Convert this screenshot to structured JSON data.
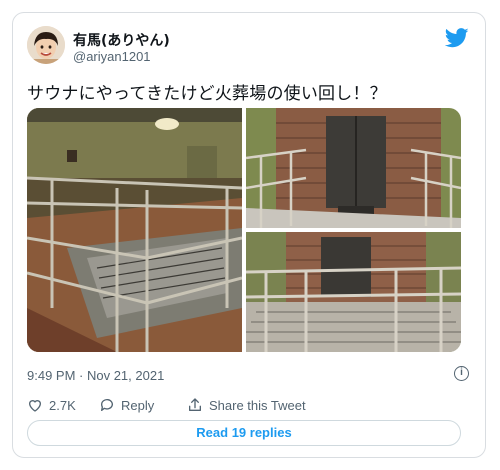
{
  "user": {
    "display_name": "有馬(ありやん)",
    "handle": "@ariyan1201",
    "avatar_icon": "user-avatar"
  },
  "logo_icon": "twitter-bird-icon",
  "brand_color": "#1d9bf0",
  "tweet": {
    "text": "サウナにやってきたけど火葬場の使い回し！？",
    "timestamp": "9:49 PM · Nov 21, 2021"
  },
  "actions": {
    "like_count": "2.7K",
    "reply_label": "Reply",
    "share_label": "Share this Tweet"
  },
  "footer": {
    "read_replies_label": "Read 19 replies"
  }
}
